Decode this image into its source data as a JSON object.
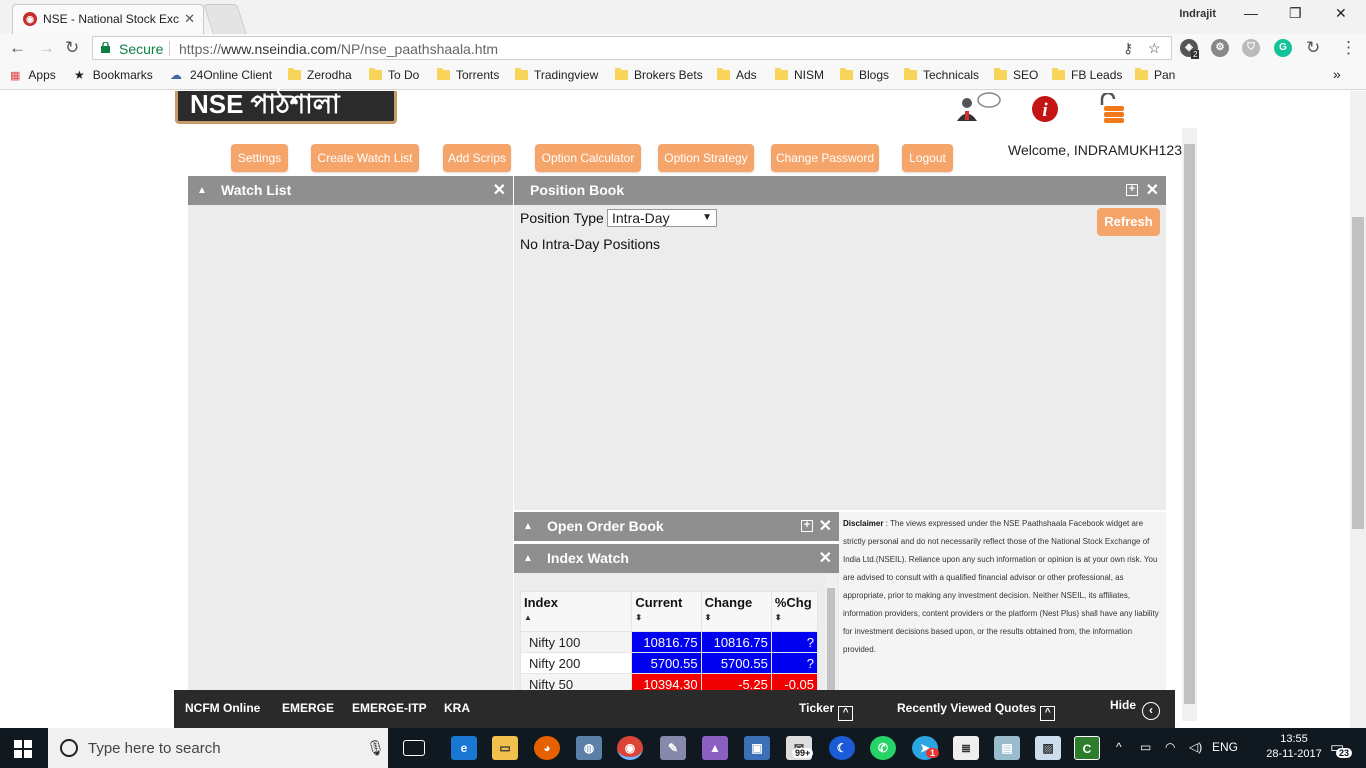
{
  "browser": {
    "tab_title": "NSE - National Stock Exc",
    "user": "Indrajit",
    "secure_label": "Secure",
    "url_prefix": "https://",
    "url_domain": "www.nseindia.com",
    "url_path": "/NP/nse_paathshaala.htm",
    "ext_badge": "2",
    "bookmarks": [
      {
        "label": "Apps",
        "type": "apps"
      },
      {
        "label": "Bookmarks",
        "type": "star"
      },
      {
        "label": "24Online Client",
        "type": "site"
      },
      {
        "label": "Zerodha",
        "type": "folder"
      },
      {
        "label": "To Do",
        "type": "folder"
      },
      {
        "label": "Torrents",
        "type": "folder"
      },
      {
        "label": "Tradingview",
        "type": "folder"
      },
      {
        "label": "Brokers Bets",
        "type": "folder"
      },
      {
        "label": "Ads",
        "type": "folder"
      },
      {
        "label": "NISM",
        "type": "folder"
      },
      {
        "label": "Blogs",
        "type": "folder"
      },
      {
        "label": "Technicals",
        "type": "folder"
      },
      {
        "label": "SEO",
        "type": "folder"
      },
      {
        "label": "FB Leads",
        "type": "folder"
      },
      {
        "label": "Pan",
        "type": "folder"
      }
    ],
    "bookmarks_more": "»"
  },
  "header": {
    "logo_text": "NSE পাঠশালা",
    "welcome": "Welcome, INDRAMUKH123"
  },
  "nav": [
    {
      "label": "Settings"
    },
    {
      "label": "Create Watch List"
    },
    {
      "label": "Add Scrips"
    },
    {
      "label": "Option Calculator"
    },
    {
      "label": "Option Strategy"
    },
    {
      "label": "Change Password"
    },
    {
      "label": "Logout"
    }
  ],
  "watch_list": {
    "title": "Watch List"
  },
  "position_book": {
    "title": "Position Book",
    "type_label": "Position Type :",
    "type_value": "Intra-Day",
    "empty_text": "No Intra-Day Positions",
    "refresh": "Refresh"
  },
  "open_order_book": {
    "title": "Open Order Book"
  },
  "index_watch": {
    "title": "Index Watch",
    "columns": [
      "Index",
      "Current",
      "Change",
      "%Chg"
    ],
    "rows": [
      {
        "index": "Nifty 100",
        "current": "10816.75",
        "change": "10816.75",
        "pct": "?",
        "color": "#0000f0"
      },
      {
        "index": "Nifty 200",
        "current": "5700.55",
        "change": "5700.55",
        "pct": "?",
        "color": "#0000f0"
      },
      {
        "index": "Nifty 50",
        "current": "10394.30",
        "change": "-5.25",
        "pct": "-0.05",
        "color": "#f00000"
      }
    ]
  },
  "disclaimer": {
    "label": "Disclaimer",
    "text": " : The views expressed under the NSE Paathshaala Facebook widget are strictly personal and do not necessarily reflect those of the National Stock Exchange of India Ltd.(NSEIL). Reliance upon any such information or opinion is at your own risk. You are advised to consult with a qualified financial advisor or other professional, as appropriate, prior to making any investment decision. Neither NSEIL, its affiliates, information providers, content providers or the platform (Nest Plus) shall have any liability for investment decisions based upon, or the results obtained from, the information provided."
  },
  "bottom_bar": {
    "links": [
      "NCFM Online",
      "EMERGE",
      "EMERGE-ITP",
      "KRA"
    ],
    "ticker": "Ticker",
    "recent": "Recently Viewed Quotes",
    "hide": "Hide"
  },
  "taskbar": {
    "search_placeholder": "Type here to search",
    "badge_mail": "99+",
    "badge_telegram": "1",
    "lang": "ENG",
    "time": "13:55",
    "date": "28-11-2017",
    "notif_count": "23"
  }
}
